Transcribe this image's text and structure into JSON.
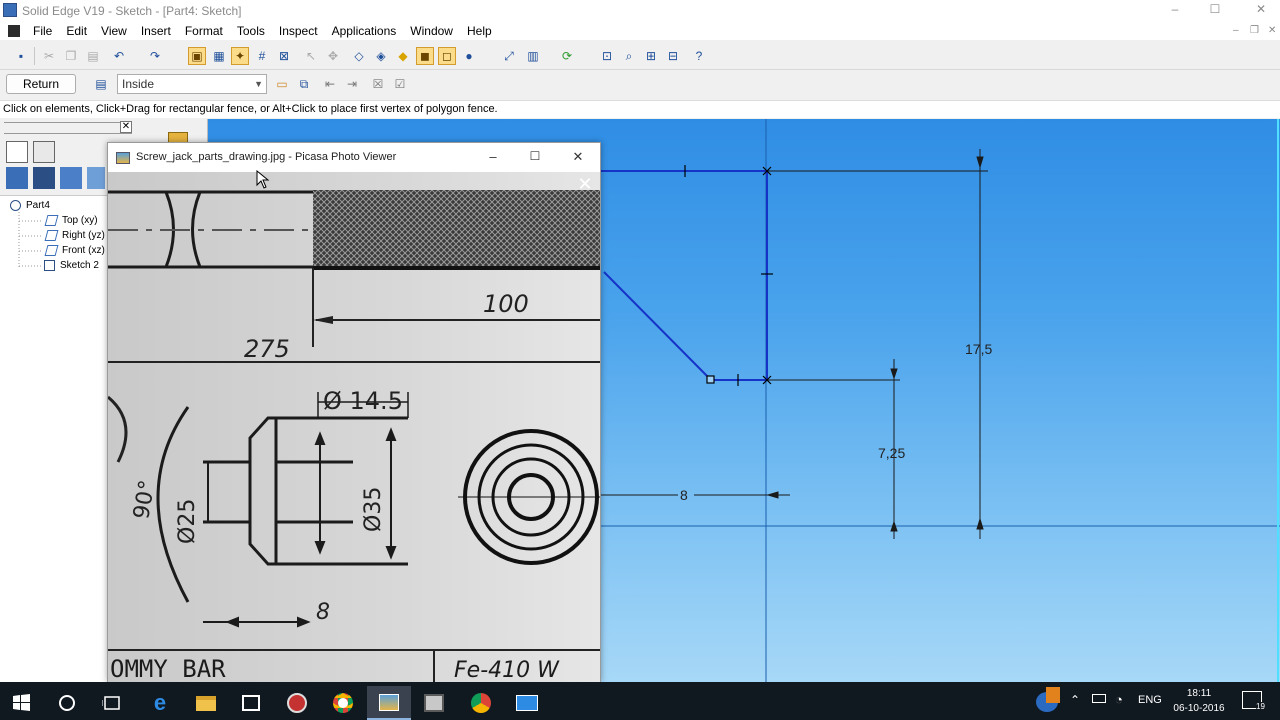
{
  "window": {
    "title": "Solid Edge V19 - Sketch - [Part4: Sketch]",
    "controls": [
      "–",
      "☐",
      "✕"
    ]
  },
  "menu": {
    "items": [
      "File",
      "Edit",
      "View",
      "Insert",
      "Format",
      "Tools",
      "Inspect",
      "Applications",
      "Window",
      "Help"
    ]
  },
  "command_bar": {
    "return_label": "Return",
    "select_mode": "Inside"
  },
  "prompt": {
    "text": "Click on elements, Click+Drag for rectangular fence, or Alt+Click to place first vertex of polygon fence."
  },
  "pathfinder": {
    "tree": [
      "Part4",
      "Top (xy)",
      "Right (yz)",
      "Front (xz)",
      "Sketch 2"
    ]
  },
  "sketch": {
    "dimensions": {
      "overall_height": "17,5",
      "lower_height": "7,25",
      "horizontal": "8"
    },
    "colors": {
      "profile": "#1633c8",
      "dim_line": "#1a1a1a"
    }
  },
  "picasa": {
    "title": "Screw_jack_parts_drawing.jpg - Picasa Photo Viewer",
    "image_labels": {
      "dim_100": "100",
      "dim_275": "275",
      "dia_145": "Ø 14.5",
      "dia_25": "Ø25",
      "dia_35": "Ø35",
      "angle_90": "90°",
      "dim_8": "8",
      "part_name": "OMMY BAR",
      "material": "Fe-410 W"
    }
  },
  "taskbar": {
    "language": "ENG",
    "time": "18:11",
    "date": "06-10-2016",
    "notification_count": "19"
  }
}
